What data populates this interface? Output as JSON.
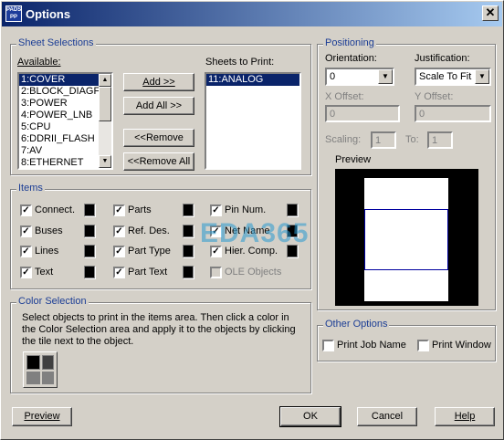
{
  "window": {
    "title": "Options",
    "icon_text": "PADS\nPP"
  },
  "sheet_selections": {
    "group_title": "Sheet Selections",
    "available_label": "Available:",
    "available_items": [
      "1:COVER",
      "2:BLOCK_DIAGF",
      "3:POWER",
      "4:POWER_LNB",
      "5:CPU",
      "6:DDRII_FLASH",
      "7:AV",
      "8:ETHERNET"
    ],
    "buttons": {
      "add": "Add >>",
      "add_all": "Add All >>",
      "remove": "<<Remove",
      "remove_all": "<<Remove All"
    },
    "sheets_to_print_label": "Sheets to Print:",
    "sheets_to_print": [
      "11:ANALOG"
    ]
  },
  "items": {
    "group_title": "Items",
    "col1": [
      {
        "label": "Connect.",
        "checked": true
      },
      {
        "label": "Buses",
        "checked": true
      },
      {
        "label": "Lines",
        "checked": true
      },
      {
        "label": "Text",
        "checked": true
      }
    ],
    "col2": [
      {
        "label": "Parts",
        "checked": true
      },
      {
        "label": "Ref. Des.",
        "checked": true
      },
      {
        "label": "Part Type",
        "checked": true
      },
      {
        "label": "Part Text",
        "checked": true
      }
    ],
    "col3": [
      {
        "label": "Pin Num.",
        "checked": true
      },
      {
        "label": "Net Name",
        "checked": true
      },
      {
        "label": "Hier. Comp.",
        "checked": true
      },
      {
        "label": "OLE Objects",
        "checked": false,
        "disabled": true
      }
    ]
  },
  "color_selection": {
    "group_title": "Color Selection",
    "instructions": "Select objects to print in the items area. Then click a color in the Color Selection area and apply it to the objects by clicking the tile next to the object."
  },
  "positioning": {
    "group_title": "Positioning",
    "orientation_label": "Orientation:",
    "orientation_value": "0",
    "justification_label": "Justification:",
    "justification_value": "Scale To Fit",
    "x_offset_label": "X Offset:",
    "x_offset_value": "0",
    "y_offset_label": "Y Offset:",
    "y_offset_value": "0",
    "scaling_label": "Scaling:",
    "scaling_from": "1",
    "to_label": "To:",
    "scaling_to": "1",
    "preview_label": "Preview"
  },
  "other_options": {
    "group_title": "Other Options",
    "print_job_name": "Print Job Name",
    "print_window": "Print Window"
  },
  "footer": {
    "preview": "Preview",
    "ok": "OK",
    "cancel": "Cancel",
    "help": "Help"
  },
  "watermark": "EDA365",
  "colors": {
    "title_start": "#0a246a",
    "title_end": "#a6caf0",
    "group_title": "#1b3d95",
    "selection": "#0a246a"
  }
}
